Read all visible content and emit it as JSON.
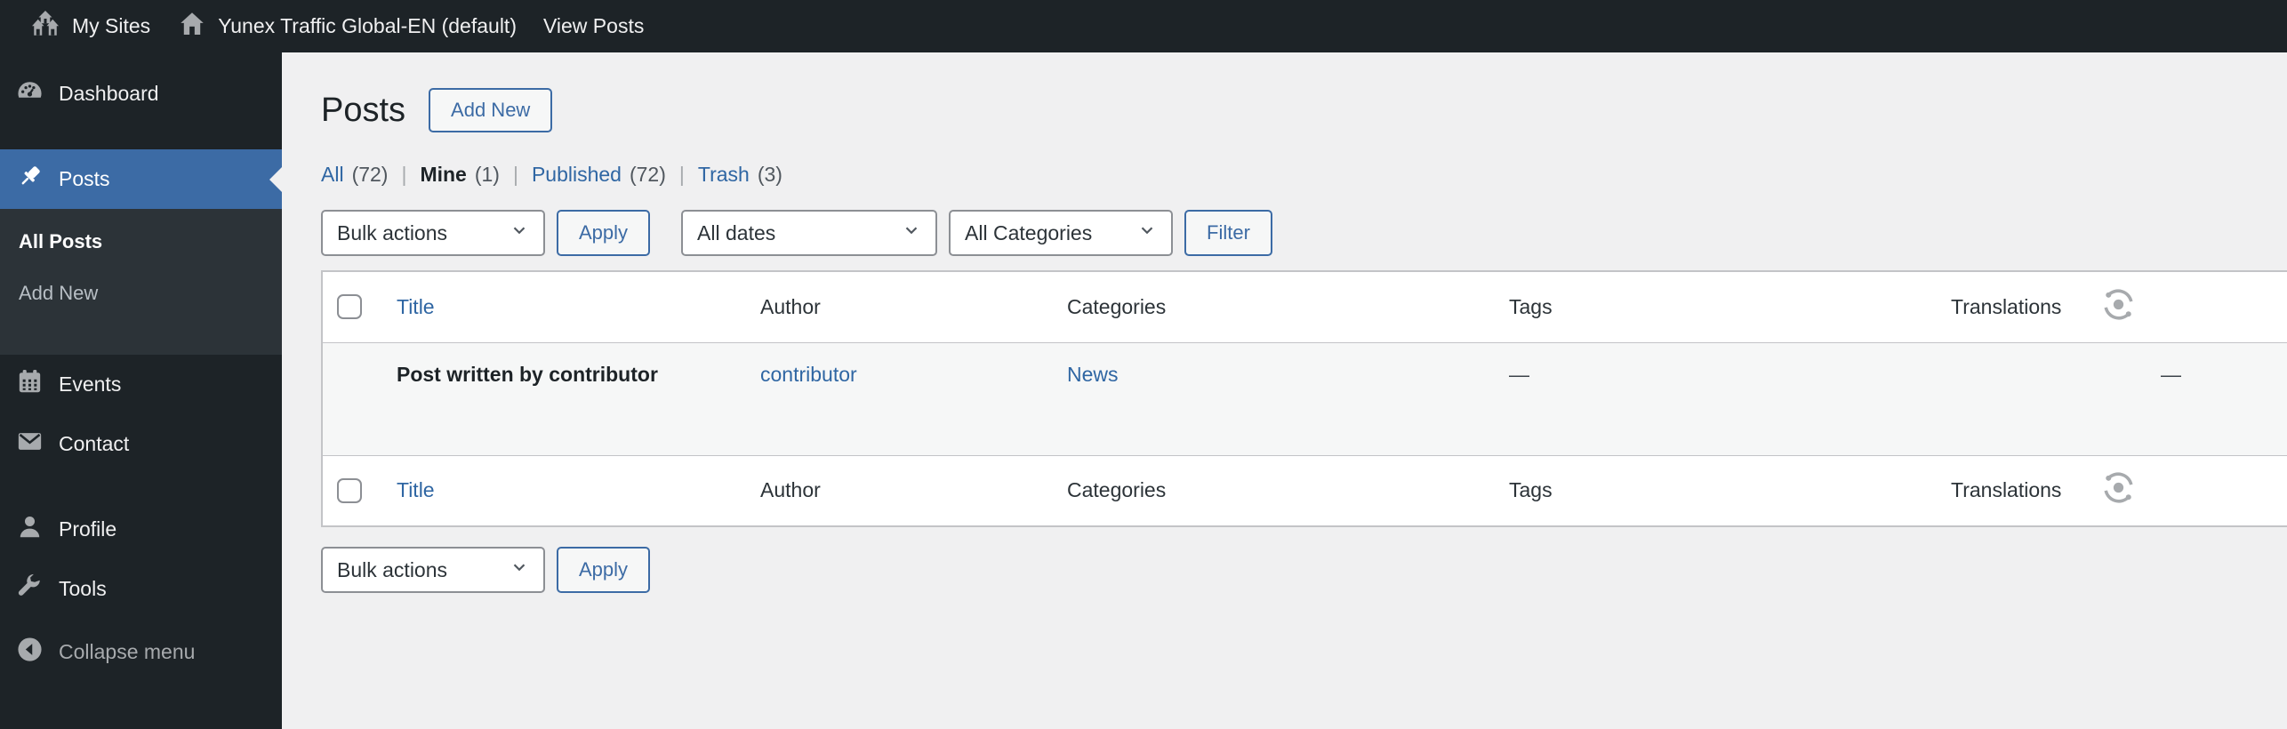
{
  "admin_bar": {
    "my_sites_label": "My Sites",
    "site_label": "Yunex Traffic Global-EN (default)",
    "view_posts_label": "View Posts"
  },
  "sidebar": {
    "dashboard": "Dashboard",
    "posts": "Posts",
    "all_posts": "All Posts",
    "add_new": "Add New",
    "events": "Events",
    "contact": "Contact",
    "profile": "Profile",
    "tools": "Tools",
    "collapse": "Collapse menu"
  },
  "page": {
    "title": "Posts",
    "add_new_button": "Add New"
  },
  "views": {
    "all": "All",
    "all_count": "(72)",
    "mine": "Mine",
    "mine_count": "(1)",
    "published": "Published",
    "published_count": "(72)",
    "trash": "Trash",
    "trash_count": "(3)",
    "separator": "|"
  },
  "toolbar": {
    "bulk_actions": "Bulk actions",
    "apply": "Apply",
    "all_dates": "All dates",
    "all_categories": "All Categories",
    "filter": "Filter"
  },
  "table": {
    "columns": {
      "title": "Title",
      "author": "Author",
      "categories": "Categories",
      "tags": "Tags",
      "translations": "Translations"
    },
    "rows": [
      {
        "title": "Post written by contributor",
        "author": "contributor",
        "category": "News",
        "tags": "—",
        "translations": "—"
      }
    ]
  },
  "icons": {
    "my_sites": "multisite-houses",
    "site": "home",
    "dashboard": "gauge",
    "posts": "pushpin",
    "events": "calendar",
    "contact": "envelope",
    "profile": "person",
    "tools": "wrench",
    "collapse": "circle-arrow-left",
    "translations": "sync-circle",
    "select_chevron": "chevron-down"
  },
  "colors": {
    "admin_bar_bg": "#1d2327",
    "sidebar_bg": "#1d2327",
    "submenu_bg": "#2c3338",
    "menu_highlight": "#3c6ba5",
    "link_blue": "#2f66a3",
    "content_bg": "#f0f0f1",
    "table_border": "#c3c4c7",
    "row_stripe_bg": "#f6f7f7",
    "icon_gray": "#a7aaad",
    "text_dark": "#1d2327"
  }
}
